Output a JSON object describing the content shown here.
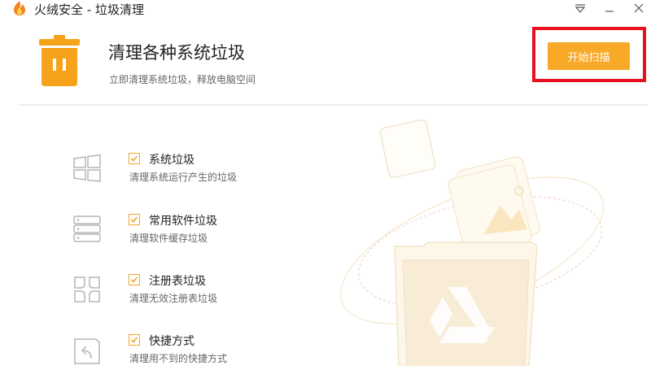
{
  "window": {
    "title": "火绒安全 - 垃圾清理"
  },
  "header": {
    "title": "清理各种系统垃圾",
    "subtitle": "立即清理系统垃圾，释放电脑空间",
    "scan_button": "开始扫描"
  },
  "colors": {
    "accent": "#f8a928",
    "highlight": "#e8101e"
  },
  "items": [
    {
      "title": "系统垃圾",
      "desc": "清理系统运行产生的垃圾",
      "checked": true,
      "icon": "windows-icon"
    },
    {
      "title": "常用软件垃圾",
      "desc": "清理软件缓存垃圾",
      "checked": true,
      "icon": "server-stack-icon"
    },
    {
      "title": "注册表垃圾",
      "desc": "清理无效注册表垃圾",
      "checked": true,
      "icon": "registry-grid-icon"
    },
    {
      "title": "快捷方式",
      "desc": "清理用不到的快捷方式",
      "checked": true,
      "icon": "shortcut-icon"
    }
  ]
}
